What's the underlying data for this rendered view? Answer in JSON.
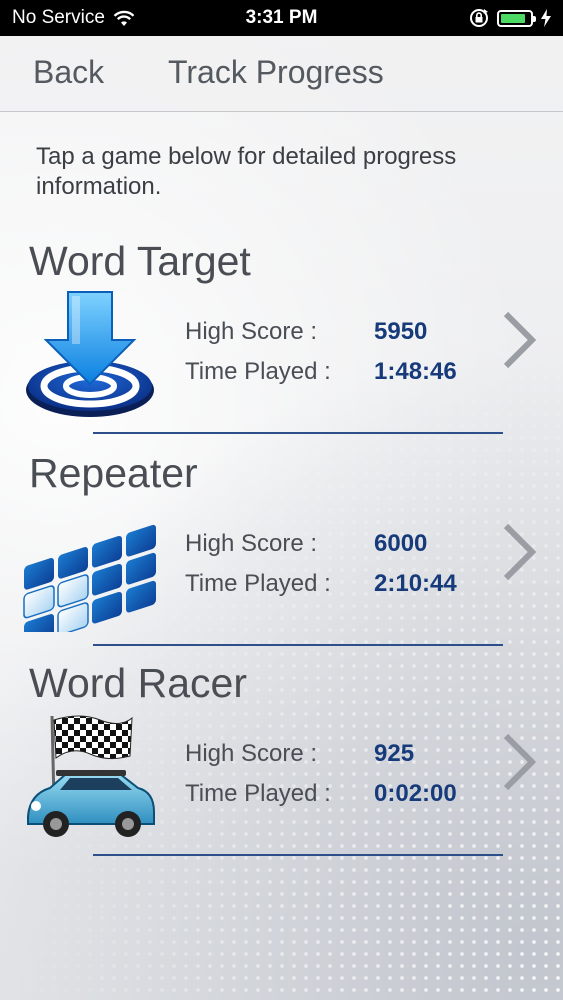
{
  "status_bar": {
    "carrier": "No Service",
    "time": "3:31 PM",
    "battery_level": 0.85,
    "icons": [
      "wifi-icon",
      "rotation-lock-icon",
      "battery-icon",
      "charging-icon"
    ]
  },
  "nav": {
    "back_label": "Back",
    "title": "Track Progress"
  },
  "instructions": "Tap a game below for detailed progress information.",
  "colors": {
    "accent_value": "#163a7a",
    "divider": "#2d4f8a",
    "text": "#4a4e54"
  },
  "games": [
    {
      "title": "Word Target",
      "icon": "target-arrow-icon",
      "high_score_label": "High Score :",
      "high_score": "5950",
      "time_played_label": "Time Played :",
      "time_played": "1:48:46"
    },
    {
      "title": "Repeater",
      "icon": "tile-grid-icon",
      "high_score_label": "High Score :",
      "high_score": "6000",
      "time_played_label": "Time Played :",
      "time_played": "2:10:44"
    },
    {
      "title": "Word Racer",
      "icon": "race-car-flag-icon",
      "high_score_label": "High Score :",
      "high_score": "925",
      "time_played_label": "Time Played :",
      "time_played": "0:02:00"
    }
  ]
}
